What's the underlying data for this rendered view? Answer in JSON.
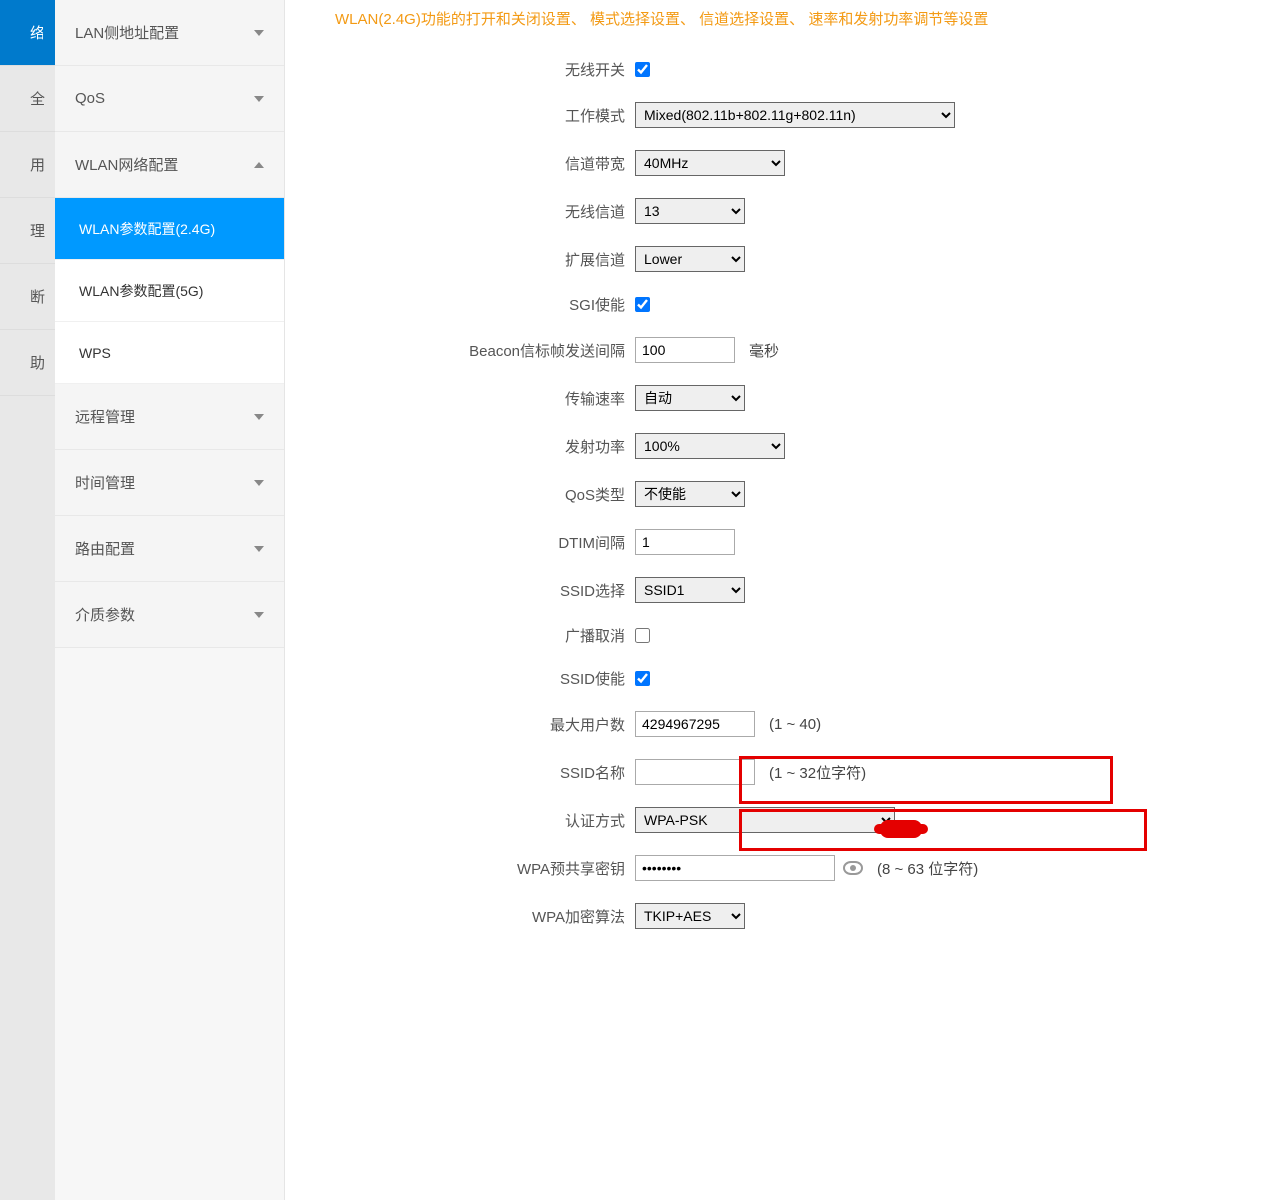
{
  "nav_strip": [
    "络",
    "全",
    "用",
    "理",
    "断",
    "助"
  ],
  "sidebar": {
    "top_partial": "",
    "items": [
      {
        "label": "LAN侧地址配置",
        "type": "group"
      },
      {
        "label": "QoS",
        "type": "group"
      },
      {
        "label": "WLAN网络配置",
        "type": "group-open",
        "children": [
          {
            "label": "WLAN参数配置(2.4G)",
            "active": true
          },
          {
            "label": "WLAN参数配置(5G)"
          },
          {
            "label": "WPS"
          }
        ]
      },
      {
        "label": "远程管理",
        "type": "group"
      },
      {
        "label": "时间管理",
        "type": "group"
      },
      {
        "label": "路由配置",
        "type": "group"
      },
      {
        "label": "介质参数",
        "type": "group"
      }
    ]
  },
  "page_desc": "WLAN(2.4G)功能的打开和关闭设置、 模式选择设置、 信道选择设置、 速率和发射功率调节等设置",
  "labels": {
    "wireless_switch": "无线开关",
    "work_mode": "工作模式",
    "channel_bw": "信道带宽",
    "wireless_channel": "无线信道",
    "ext_channel": "扩展信道",
    "sgi_enable": "SGI使能",
    "beacon_interval": "Beacon信标帧发送间隔",
    "beacon_unit": "毫秒",
    "tx_rate": "传输速率",
    "tx_power": "发射功率",
    "qos_type": "QoS类型",
    "dtim_interval": "DTIM间隔",
    "ssid_select": "SSID选择",
    "broadcast_cancel": "广播取消",
    "ssid_enable": "SSID使能",
    "max_users": "最大用户数",
    "max_users_hint": "(1 ~ 40)",
    "ssid_name": "SSID名称",
    "ssid_name_hint": "(1 ~ 32位字符)",
    "auth_type": "认证方式",
    "wpa_psk": "WPA预共享密钥",
    "wpa_psk_hint": "(8 ~ 63 位字符)",
    "wpa_algo": "WPA加密算法"
  },
  "values": {
    "wireless_switch": true,
    "work_mode": "Mixed(802.11b+802.11g+802.11n)",
    "channel_bw": "40MHz",
    "wireless_channel": "13",
    "ext_channel": "Lower",
    "sgi_enable": true,
    "beacon_interval": "100",
    "tx_rate": "自动",
    "tx_power": "100%",
    "qos_type": "不使能",
    "dtim_interval": "1",
    "ssid_select": "SSID1",
    "broadcast_cancel": false,
    "ssid_enable": true,
    "max_users": "4294967295",
    "ssid_name": "",
    "auth_type": "WPA-PSK",
    "wpa_psk": "••••••••",
    "wpa_algo": "TKIP+AES"
  }
}
